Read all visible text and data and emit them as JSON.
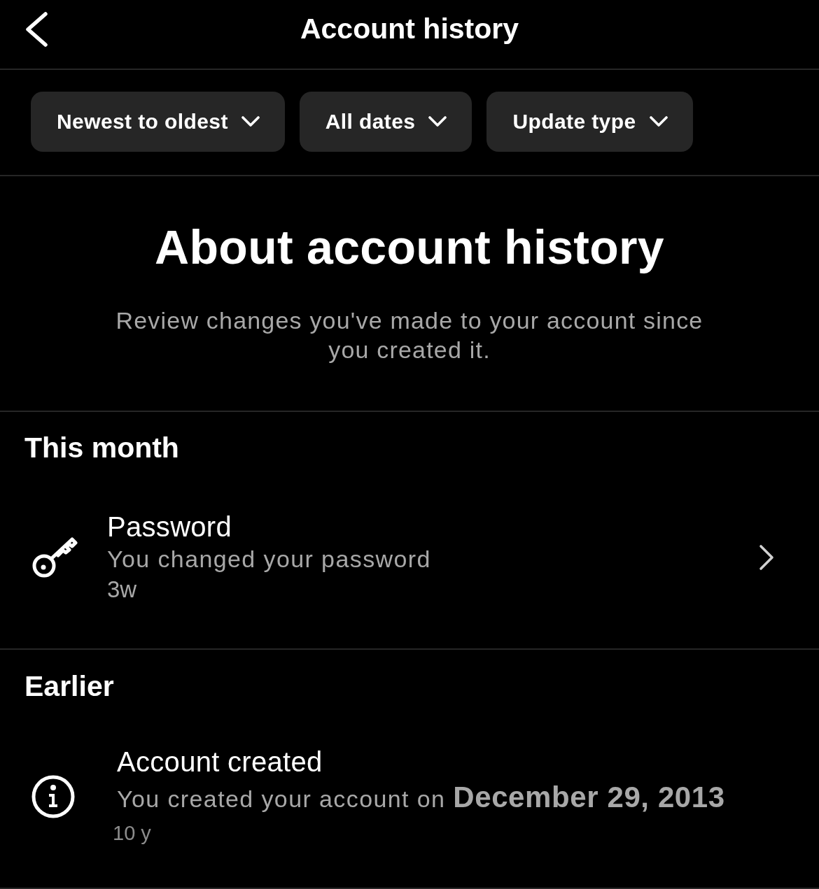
{
  "header": {
    "title": "Account history"
  },
  "filters": [
    {
      "label": "Newest to oldest"
    },
    {
      "label": "All dates"
    },
    {
      "label": "Update type"
    }
  ],
  "about": {
    "title": "About account history",
    "description": "Review changes you've made to your account since you created it."
  },
  "sections": [
    {
      "title": "This month",
      "items": [
        {
          "kind": "password",
          "title": "Password",
          "subtitle": "You changed your password",
          "time": "3w",
          "opens_detail": true
        }
      ]
    },
    {
      "title": "Earlier",
      "items": [
        {
          "kind": "info",
          "title": "Account created",
          "subtitle": "You created your account on **December 29, 2013**",
          "time": "10 y",
          "opens_detail": false
        }
      ]
    }
  ]
}
